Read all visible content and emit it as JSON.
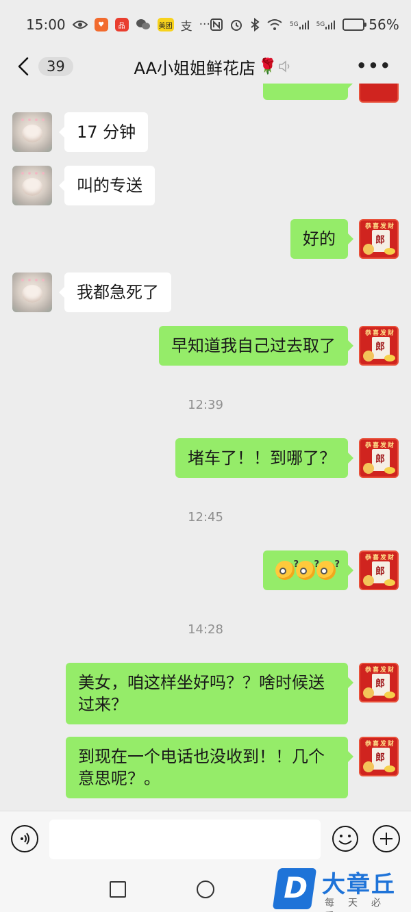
{
  "status_bar": {
    "time": "15:00",
    "more": "···",
    "signal1": "5G",
    "signal2": "5G",
    "battery": "56%",
    "battery_level": 0.56,
    "icons": [
      "eye-icon",
      "app-icon-orange",
      "app-icon-red",
      "wechat-icon",
      "meituan-icon",
      "alipay-icon",
      "nfc-icon",
      "alarm-icon",
      "bluetooth-icon",
      "wifi-icon"
    ]
  },
  "header": {
    "unread_count": "39",
    "title": "AA小姐姐鲜花店",
    "title_emoji": "🌹"
  },
  "messages": [
    {
      "side": "in",
      "text": "17 分钟"
    },
    {
      "side": "in",
      "text": "叫的专送"
    },
    {
      "side": "out",
      "text": "好的"
    },
    {
      "side": "in",
      "text": "我都急死了"
    },
    {
      "side": "out",
      "text": "早知道我自己过去取了"
    },
    {
      "type": "time",
      "text": "12:39"
    },
    {
      "side": "out",
      "text": "堵车了！！到哪了？"
    },
    {
      "type": "time",
      "text": "12:45"
    },
    {
      "side": "out",
      "type": "emoji",
      "emoji": [
        "confused-emoji",
        "confused-emoji",
        "confused-emoji"
      ]
    },
    {
      "type": "time",
      "text": "14:28"
    },
    {
      "side": "out",
      "text": "美女，咱这样坐好吗？？啥时候送过来？"
    },
    {
      "side": "out",
      "text": "到现在一个电话也没收到！！几个意思呢？。"
    }
  ],
  "avatar_red": {
    "top_text": "恭喜发财",
    "char": "郎"
  },
  "input": {
    "placeholder": ""
  },
  "watermark": {
    "logo_letter": "D",
    "title": "大章丘",
    "subtitle": "每天必看"
  },
  "colors": {
    "background": "#ededed",
    "outgoing": "#95ec69",
    "incoming": "#ffffff",
    "watermark": "#1e73d8"
  }
}
